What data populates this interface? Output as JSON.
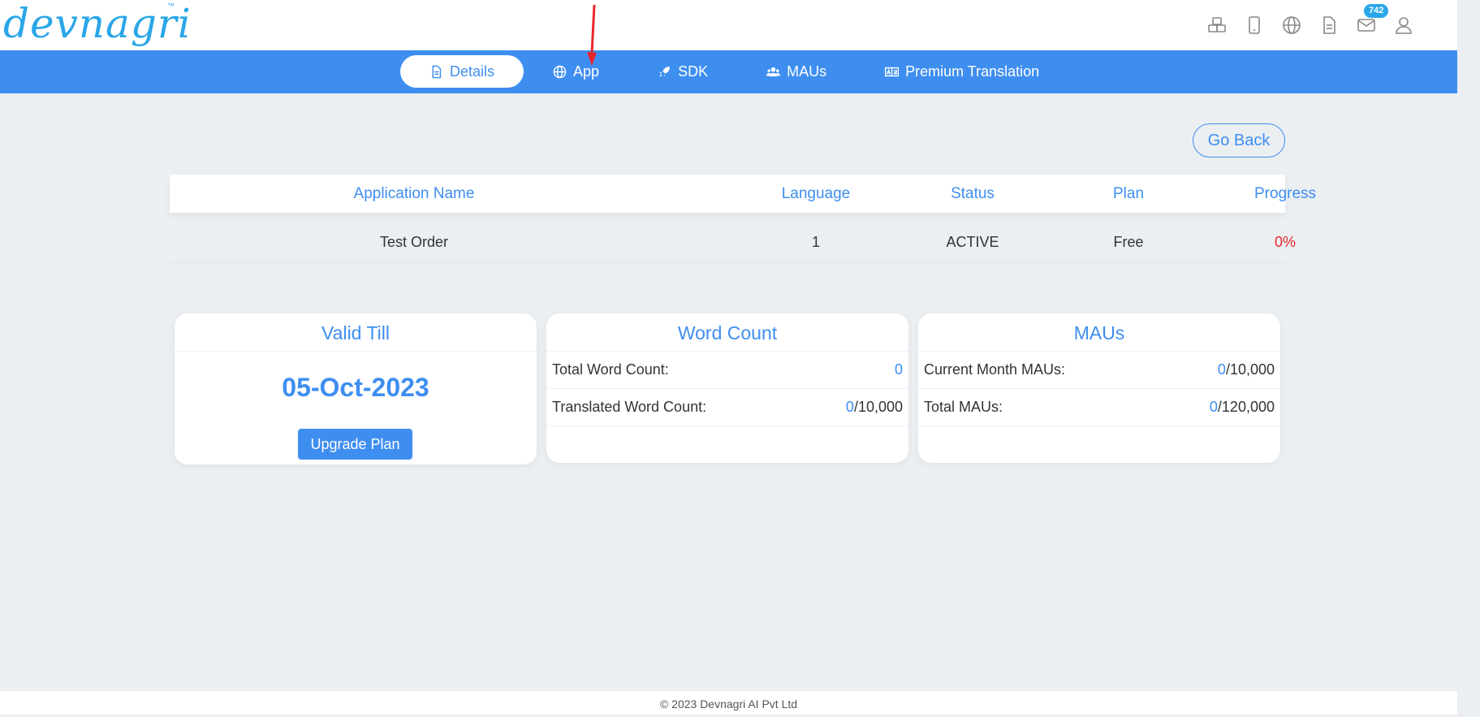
{
  "logo": {
    "text": "devnagri",
    "tm": "™"
  },
  "top_icons": [
    {
      "name": "boxes-icon"
    },
    {
      "name": "mobile-icon"
    },
    {
      "name": "globe-icon"
    },
    {
      "name": "document-icon"
    },
    {
      "name": "mail-icon",
      "badge": "742"
    },
    {
      "name": "user-icon"
    }
  ],
  "nav": {
    "items": [
      {
        "label": "Details",
        "icon": "file-icon",
        "active": true
      },
      {
        "label": "App",
        "icon": "globe-icon"
      },
      {
        "label": "SDK",
        "icon": "rocket-icon"
      },
      {
        "label": "MAUs",
        "icon": "users-icon"
      },
      {
        "label": "Premium Translation",
        "icon": "translate-icon"
      }
    ]
  },
  "go_back_label": "Go Back",
  "table": {
    "headers": [
      "Application Name",
      "Language",
      "Status",
      "Plan",
      "Progress"
    ],
    "row": [
      "Test Order",
      "1",
      "ACTIVE",
      "Free",
      "0%"
    ]
  },
  "cards": {
    "valid_till": {
      "title": "Valid Till",
      "date": "05-Oct-2023",
      "button": "Upgrade Plan"
    },
    "word_count": {
      "title": "Word Count",
      "rows": [
        {
          "label": "Total Word Count:",
          "value": "0",
          "total": ""
        },
        {
          "label": "Translated Word Count:",
          "value": "0",
          "total": "/10,000"
        }
      ]
    },
    "maus": {
      "title": "MAUs",
      "rows": [
        {
          "label": "Current Month MAUs:",
          "value": "0",
          "total": "/10,000"
        },
        {
          "label": "Total MAUs:",
          "value": "0",
          "total": "/120,000"
        }
      ]
    }
  },
  "footer": "© 2023 Devnagri AI Pvt Ltd",
  "colors": {
    "primary": "#3e8ef0",
    "logo": "#2aa6e8",
    "progress": "#e8262c",
    "background": "#ebeff2"
  }
}
